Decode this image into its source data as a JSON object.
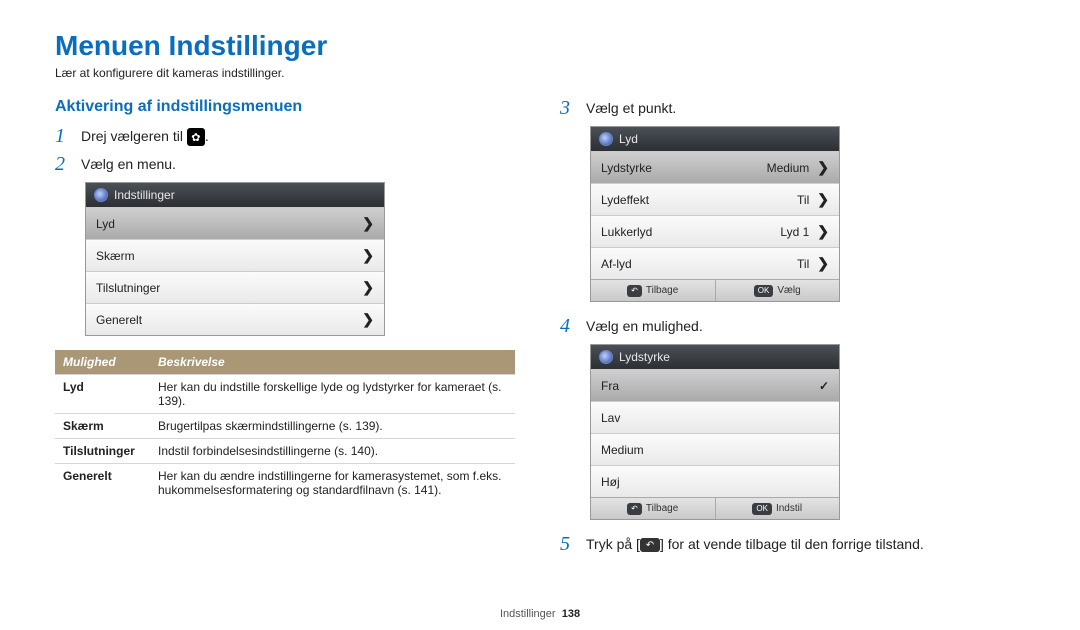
{
  "title": "Menuen Indstillinger",
  "subtitle": "Lær at konfigurere dit kameras indstillinger.",
  "section": "Aktivering af indstillingsmenuen",
  "steps": {
    "s1a": "Drej vælgeren til ",
    "s1b": ".",
    "s2": "Vælg en menu.",
    "s3": "Vælg et punkt.",
    "s4": "Vælg en mulighed.",
    "s5a": "Tryk på [",
    "s5b": "] for at vende tilbage til den forrige tilstand."
  },
  "menu1": {
    "header": "Indstillinger",
    "items": [
      {
        "label": "Lyd"
      },
      {
        "label": "Skærm"
      },
      {
        "label": "Tilslutninger"
      },
      {
        "label": "Generelt"
      }
    ]
  },
  "menu2": {
    "header": "Lyd",
    "items": [
      {
        "label": "Lydstyrke",
        "value": "Medium",
        "selected": true
      },
      {
        "label": "Lydeffekt",
        "value": "Til"
      },
      {
        "label": "Lukkerlyd",
        "value": "Lyd 1"
      },
      {
        "label": "Af-lyd",
        "value": "Til"
      }
    ],
    "back": "Tilbage",
    "ok": "Vælg",
    "ok_key": "OK"
  },
  "menu3": {
    "header": "Lydstyrke",
    "items": [
      {
        "label": "Fra",
        "checked": true
      },
      {
        "label": "Lav"
      },
      {
        "label": "Medium"
      },
      {
        "label": "Høj"
      }
    ],
    "back": "Tilbage",
    "ok": "Indstil",
    "ok_key": "OK"
  },
  "table": {
    "head_opt": "Mulighed",
    "head_desc": "Beskrivelse",
    "rows": [
      {
        "opt": "Lyd",
        "desc": "Her kan du indstille forskellige lyde og lydstyrker for kameraet (s. 139)."
      },
      {
        "opt": "Skærm",
        "desc": "Brugertilpas skærmindstillingerne (s. 139)."
      },
      {
        "opt": "Tilslutninger",
        "desc": "Indstil forbindelsesindstillingerne (s. 140)."
      },
      {
        "opt": "Generelt",
        "desc": "Her kan du ændre indstillingerne for kamerasystemet, som f.eks. hukommelsesformatering og standardfilnavn (s. 141)."
      }
    ]
  },
  "footer": {
    "label": "Indstillinger",
    "page": "138"
  }
}
